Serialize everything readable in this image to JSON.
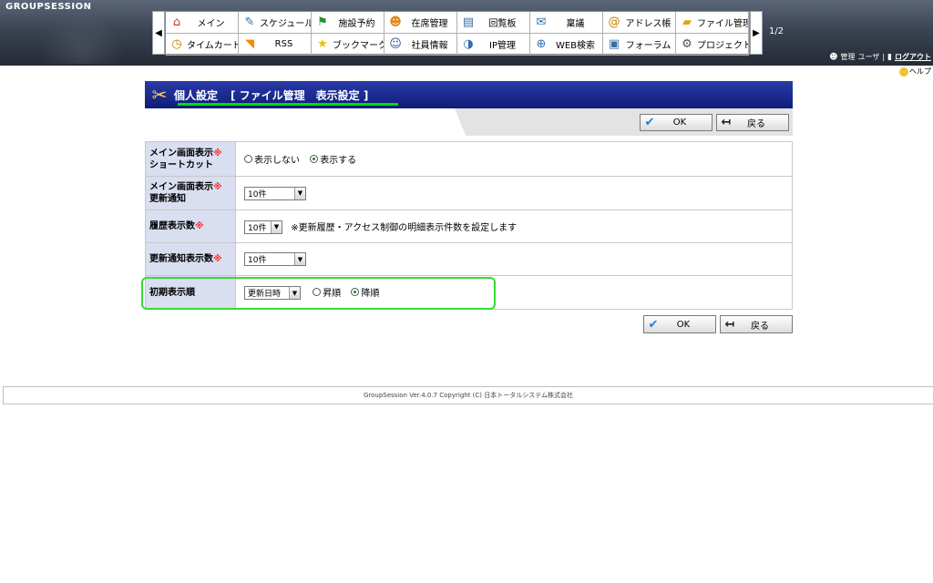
{
  "header": {
    "logo": "GROUPSESSION",
    "menu_items": [
      {
        "label": "メイン",
        "icon": "house-icon",
        "glyph": "⌂",
        "color": "#c0392b"
      },
      {
        "label": "スケジュール",
        "icon": "schedule-icon",
        "glyph": "✎",
        "color": "#3a6ea5"
      },
      {
        "label": "施設予約",
        "icon": "facility-icon",
        "glyph": "⚑",
        "color": "#2e8b2e"
      },
      {
        "label": "在席管理",
        "icon": "attendance-icon",
        "glyph": "☻",
        "color": "#e08a1e"
      },
      {
        "label": "回覧板",
        "icon": "circular-icon",
        "glyph": "▤",
        "color": "#3a6ea5"
      },
      {
        "label": "稟議",
        "icon": "approval-icon",
        "glyph": "✉",
        "color": "#3a6ea5"
      },
      {
        "label": "アドレス帳",
        "icon": "address-book-icon",
        "glyph": "@",
        "color": "#c27b00"
      },
      {
        "label": "ファイル管理",
        "icon": "folder-icon",
        "glyph": "▰",
        "color": "#e3a21a"
      },
      {
        "label": "タイムカード",
        "icon": "clock-icon",
        "glyph": "◷",
        "color": "#c27b00"
      },
      {
        "label": "RSS",
        "icon": "rss-icon",
        "glyph": "◥",
        "color": "#f28c00"
      },
      {
        "label": "ブックマーク",
        "icon": "star-icon",
        "glyph": "★",
        "color": "#e6c200"
      },
      {
        "label": "社員情報",
        "icon": "user-icon",
        "glyph": "☺",
        "color": "#2c4fa3"
      },
      {
        "label": "IP管理",
        "icon": "network-icon",
        "glyph": "◑",
        "color": "#2e6fb3"
      },
      {
        "label": "WEB検索",
        "icon": "web-search-icon",
        "glyph": "⊕",
        "color": "#2e6fb3"
      },
      {
        "label": "フォーラム",
        "icon": "forum-icon",
        "glyph": "▣",
        "color": "#3a6ea5"
      },
      {
        "label": "プロジェクト",
        "icon": "project-icon",
        "glyph": "⚙",
        "color": "#555555"
      }
    ],
    "page_indicator": "1/2",
    "user_link_admin": "管理",
    "user_link_user": "ユーザ",
    "logout": "ログアウト",
    "help": "ヘルプ"
  },
  "title": {
    "main": "個人設定",
    "sub": "[ ファイル管理　表示設定 ]"
  },
  "buttons": {
    "ok": "OK",
    "back": "戻る"
  },
  "form": {
    "rows": [
      {
        "label_line1": "メイン画面表示",
        "label_line2": "ショートカット",
        "required": "※",
        "radio1": "表示しない",
        "radio2": "表示する",
        "selected": 2
      },
      {
        "label_line1": "メイン画面表示",
        "label_line2": "更新通知",
        "required": "※",
        "select_value": "10件"
      },
      {
        "label": "履歴表示数",
        "required": "※",
        "select_value": "10件",
        "note": "※更新履歴・アクセス制御の明細表示件数を設定します"
      },
      {
        "label": "更新通知表示数",
        "required": "※",
        "select_value": "10件"
      },
      {
        "label": "初期表示順",
        "select_value": "更新日時",
        "radio1": "昇順",
        "radio2": "降順",
        "selected": 2
      }
    ]
  },
  "footer": {
    "text": "GroupSession Ver.4.0.7 Copyright (C) 日本トータルシステム株式会社"
  },
  "colors": {
    "header_bg": "#3b4452",
    "title_bar": "#1a2a96",
    "label_bg": "#d9def0",
    "highlight": "#33dd33"
  }
}
